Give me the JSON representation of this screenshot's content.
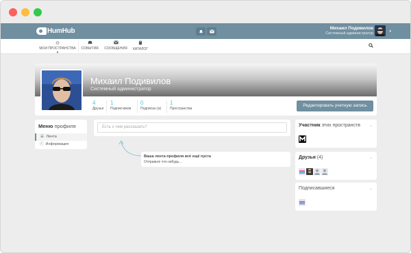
{
  "app": {
    "logo_text": "HumHub"
  },
  "topbar": {
    "user_name": "Михаил Подивилов",
    "user_role": "Системный администратор",
    "icons": [
      "bell-icon",
      "envelope-icon"
    ]
  },
  "nav": {
    "items": [
      {
        "label": "Мои пространства ▾",
        "icon": "dot-circle-icon"
      },
      {
        "label": "События",
        "icon": "car-icon"
      },
      {
        "label": "Сообщения",
        "icon": "envelope-icon"
      },
      {
        "label": "Каталог",
        "icon": "book-icon"
      }
    ],
    "search_icon": "search-icon"
  },
  "profile": {
    "name": "Михаил Подивилов",
    "title": "Системный администратор",
    "stats": [
      {
        "value": "4",
        "label": "Друзья"
      },
      {
        "value": "1",
        "label": "Подписчиков"
      },
      {
        "value": "0",
        "label": "Подписан (а)"
      },
      {
        "value": "1",
        "label": "Пространства"
      }
    ],
    "edit_button": "Редактировать учетную запись"
  },
  "profile_menu": {
    "title_bold": "Меню",
    "title_rest": " профиля",
    "items": [
      {
        "label": "Лента",
        "icon": "list-icon"
      },
      {
        "label": "Информация",
        "icon": "info-icon"
      }
    ]
  },
  "stream": {
    "placeholder": "Есть о чем рассказать?",
    "empty_title": "Ваша лента профиля всё ещё пуста",
    "empty_sub": "Отправьте что-нибудь..."
  },
  "sidebar": {
    "member": {
      "bold": "Участник",
      "rest": " этих пространств"
    },
    "friends": {
      "bold": "Друзья",
      "rest": " (4)"
    },
    "followers": {
      "title": "Подписавшиеся"
    }
  },
  "colors": {
    "accent": "#708fa0",
    "stat_number": "#4cc5d5",
    "background": "#ededed"
  }
}
